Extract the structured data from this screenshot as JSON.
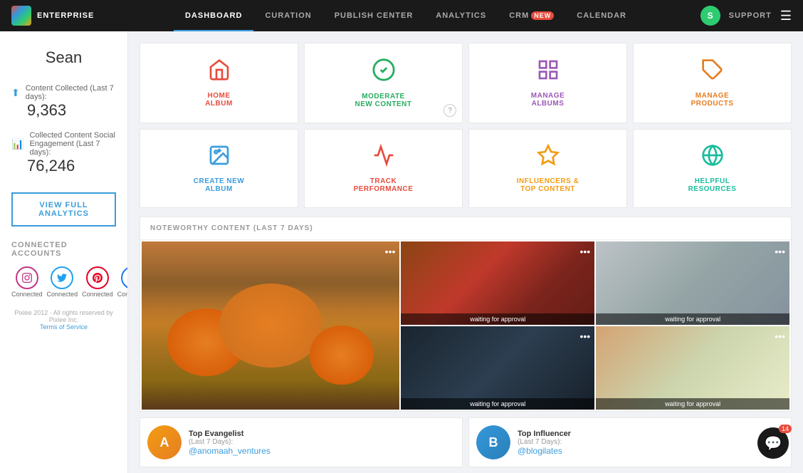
{
  "app": {
    "name": "ENTERPRISE"
  },
  "nav": {
    "links": [
      {
        "id": "dashboard",
        "label": "DASHBOARD",
        "active": true,
        "badge": null
      },
      {
        "id": "curation",
        "label": "CURATION",
        "active": false,
        "badge": null
      },
      {
        "id": "publish",
        "label": "PUBLISH CENTER",
        "active": false,
        "badge": null
      },
      {
        "id": "analytics",
        "label": "ANALYTICS",
        "active": false,
        "badge": null
      },
      {
        "id": "crm",
        "label": "CRM",
        "active": false,
        "badge": "NEW"
      },
      {
        "id": "calendar",
        "label": "CALENDAR",
        "active": false,
        "badge": null
      }
    ],
    "avatar_letter": "S",
    "support_label": "SUPPORT"
  },
  "sidebar": {
    "user_name": "Sean",
    "stats": [
      {
        "id": "content",
        "label": "Content Collected (Last 7 days):",
        "value": "9,363"
      },
      {
        "id": "engagement",
        "label": "Collected Content Social Engagement (Last 7 days):",
        "value": "76,246"
      }
    ],
    "view_button_label": "VIEW FULL ANALYTICS",
    "connected_header": "CONNECTED ACCOUNTS",
    "social_accounts": [
      {
        "id": "instagram",
        "type": "instagram",
        "label": "Connected"
      },
      {
        "id": "twitter",
        "type": "twitter",
        "label": "Connected"
      },
      {
        "id": "pinterest",
        "type": "pinterest",
        "label": "Connected"
      },
      {
        "id": "facebook",
        "type": "facebook",
        "label": "Connected"
      }
    ],
    "footer": "Pixlee 2012 · All rights reserved by Pixlee Inc.",
    "tos_label": "Terms of Service"
  },
  "tiles": [
    {
      "id": "home-album",
      "class": "home",
      "icon": "🏠",
      "label": "HOME\nALBUM"
    },
    {
      "id": "moderate",
      "class": "moderate",
      "icon": "✅",
      "label": "MODERATE\nNEW CONTENT"
    },
    {
      "id": "manage-albums",
      "class": "manage-albums",
      "icon": "⊞",
      "label": "MANAGE\nALBUMS"
    },
    {
      "id": "manage-products",
      "class": "manage-products",
      "icon": "🏷",
      "label": "MANAGE\nPRODUCTS"
    },
    {
      "id": "create-album",
      "class": "create-album",
      "icon": "📷",
      "label": "CREATE NEW\nALBUM"
    },
    {
      "id": "track",
      "class": "track",
      "icon": "📈",
      "label": "TRACK\nPERFORMANCE"
    },
    {
      "id": "influencers",
      "class": "influencers",
      "icon": "⭐",
      "label": "INFLUENCERS &\nTOP CONTENT"
    },
    {
      "id": "helpful",
      "class": "helpful",
      "icon": "🔗",
      "label": "HELPFUL\nRESOURCES"
    }
  ],
  "noteworthy": {
    "header": "NOTEWORTHY CONTENT (LAST 7 DAYS)",
    "images": [
      {
        "id": "img1",
        "size": "large",
        "status": null,
        "bg": "autumn-bg"
      },
      {
        "id": "img2",
        "size": "normal",
        "status": "waiting for approval",
        "bg": "fashion-bg"
      },
      {
        "id": "img3",
        "size": "normal",
        "status": "waiting for approval",
        "bg": "room-bg"
      },
      {
        "id": "img4",
        "size": "normal",
        "status": "waiting for approval",
        "bg": "tech-bg"
      },
      {
        "id": "img5",
        "size": "normal",
        "status": "waiting for approval",
        "bg": "spa-bg"
      }
    ]
  },
  "bottom_cards": [
    {
      "id": "evangelist",
      "type": "Top Evangelist",
      "period": "(Last 7 Days):",
      "handle": "@anomaah_ventures",
      "avatar_class": "avatar-anoma"
    },
    {
      "id": "influencer",
      "type": "Top Influencer",
      "period": "(Last 7 Days):",
      "handle": "@blogilates",
      "avatar_class": "avatar-blog"
    }
  ],
  "chat": {
    "badge": "14"
  }
}
